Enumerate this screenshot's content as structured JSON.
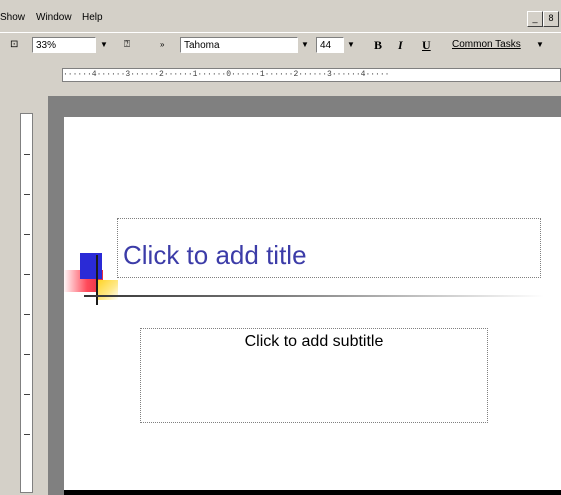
{
  "menubar": {
    "items": [
      "Show",
      "Window",
      "Help"
    ],
    "window_controls": [
      "_",
      "8"
    ]
  },
  "toolbar": {
    "zoom": "33%",
    "font": "Tahoma",
    "font_size": "44",
    "bold": "B",
    "italic": "I",
    "underline": "U",
    "common_tasks": "Common Tasks"
  },
  "ruler": {
    "horizontal": "······4······3······2······1······0······1······2······3······4·····"
  },
  "slide": {
    "title_placeholder": "Click to add title",
    "subtitle_placeholder": "Click to add subtitle"
  },
  "colors": {
    "title_text": "#3c3ca8",
    "accent_blue": "#2a2ad6",
    "accent_red": "#e23040",
    "accent_yellow": "#ffd21e"
  }
}
